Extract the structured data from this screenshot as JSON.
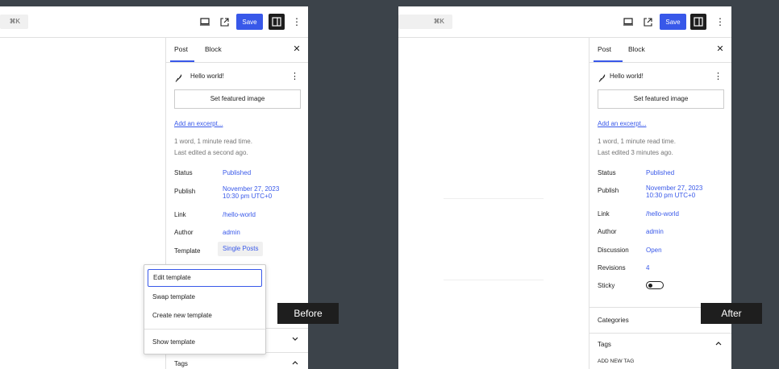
{
  "toolbar": {
    "shortcut": "⌘K",
    "save_label": "Save"
  },
  "sidebar": {
    "tab_post": "Post",
    "tab_block": "Block",
    "post_title": "Hello world!",
    "featured_image_label": "Set featured image",
    "excerpt_link": "Add an excerpt...",
    "read_time": "1 word, 1 minute read time."
  },
  "before": {
    "last_edited": "Last edited a second ago.",
    "rows": {
      "status_label": "Status",
      "status_value": "Published",
      "publish_label": "Publish",
      "publish_value_line1": "November 27, 2023",
      "publish_value_line2": "10:30 pm UTC+0",
      "link_label": "Link",
      "link_value": "/hello-world",
      "author_label": "Author",
      "author_value": "admin",
      "template_label": "Template",
      "template_value": "Single Posts"
    },
    "menu": {
      "edit_template": "Edit template",
      "swap_template": "Swap template",
      "create_new_template": "Create new template",
      "show_template": "Show template"
    },
    "tags_title": "Tags",
    "badge": "Before"
  },
  "after": {
    "last_edited": "Last edited 3 minutes ago.",
    "rows": {
      "status_label": "Status",
      "status_value": "Published",
      "publish_label": "Publish",
      "publish_value_line1": "November 27, 2023",
      "publish_value_line2": "10:30 pm UTC+0",
      "link_label": "Link",
      "link_value": "/hello-world",
      "author_label": "Author",
      "author_value": "admin",
      "discussion_label": "Discussion",
      "discussion_value": "Open",
      "revisions_label": "Revisions",
      "revisions_value": "4",
      "sticky_label": "Sticky"
    },
    "categories_title": "Categories",
    "tags_title": "Tags",
    "add_new_tag": "ADD NEW TAG",
    "badge": "After"
  },
  "colors": {
    "accent": "#3858e9",
    "backdrop": "#3c434a",
    "badge_bg": "#1e1e1e"
  }
}
